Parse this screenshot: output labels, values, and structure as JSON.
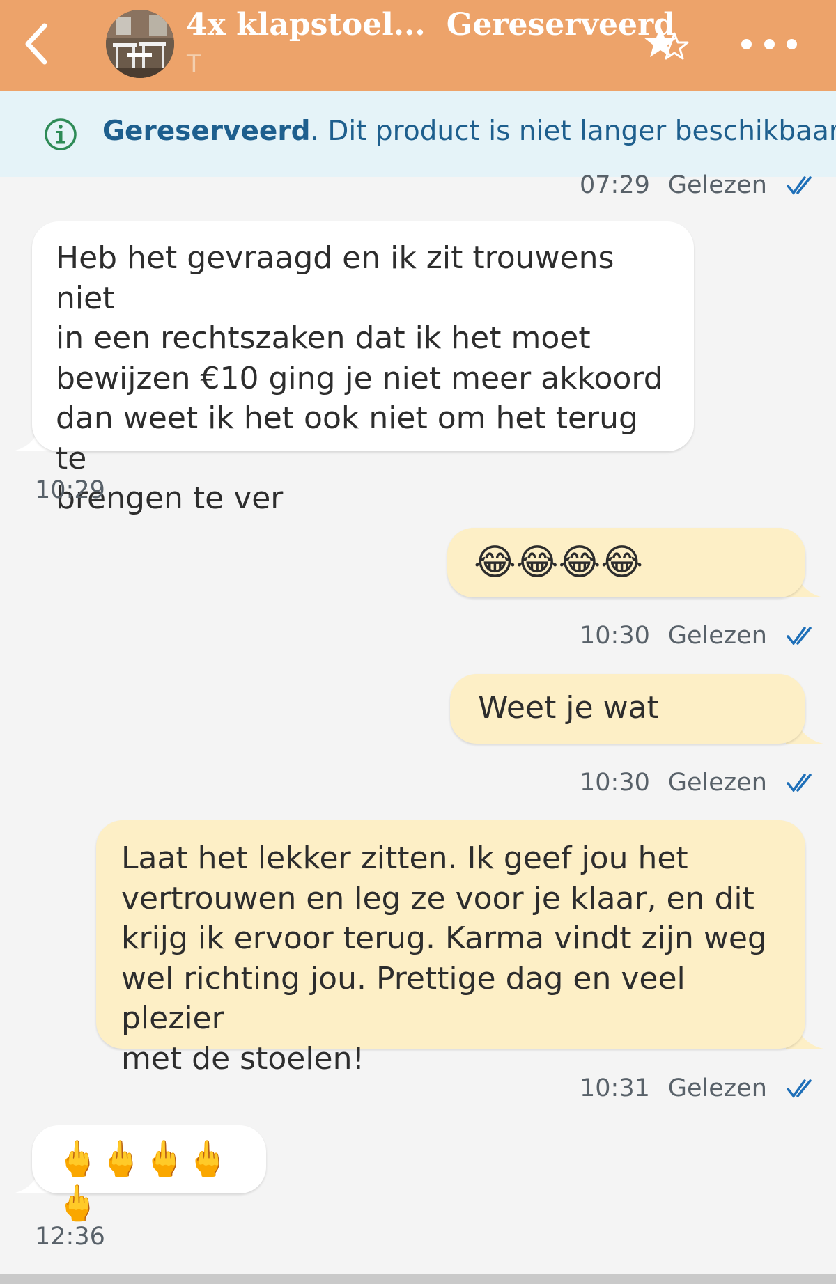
{
  "header": {
    "listing_title": "4x klapstoel...",
    "status": "Gereserveerd",
    "user_initial": "T",
    "colors": {
      "bar": "#eda36a",
      "text": "#ffffff"
    },
    "icons": {
      "back": "chevron-left-icon",
      "favorite": "star-icon",
      "more": "more-dots-icon"
    }
  },
  "banner": {
    "status_word": "Gereserveerd",
    "message": ". Dit product is niet langer beschikbaar.",
    "icon": "info-icon",
    "colors": {
      "background": "#e5f3f8",
      "text": "#1e5f8e",
      "icon": "#2e8b57"
    }
  },
  "read_label": "Gelezen",
  "messages": [
    {
      "id": "m0",
      "direction": "outgoing",
      "time": "07:29",
      "read": "Gelezen"
    },
    {
      "id": "m1",
      "direction": "incoming",
      "lines": [
        "Heb het gevraagd en ik zit trouwens niet",
        "in een rechtszaken dat ik het moet",
        "bewijzen €10 ging je niet meer akkoord",
        "dan weet ik het ook niet om het terug te",
        "brengen te ver"
      ],
      "time": "10:29"
    },
    {
      "id": "m2",
      "direction": "outgoing",
      "text": "😂😂😂😂",
      "time": "10:30",
      "read": "Gelezen"
    },
    {
      "id": "m3",
      "direction": "outgoing",
      "text": "Weet je wat",
      "time": "10:30",
      "read": "Gelezen"
    },
    {
      "id": "m4",
      "direction": "outgoing",
      "lines": [
        "Laat het lekker zitten. Ik geef jou het",
        "vertrouwen en leg ze voor je klaar, en dit",
        "krijg ik ervoor terug. Karma vindt zijn weg",
        "wel richting jou. Prettige dag en veel plezier",
        "met de stoelen!"
      ],
      "time": "10:31",
      "read": "Gelezen"
    },
    {
      "id": "m5",
      "direction": "incoming",
      "text": "🖕🖕🖕🖕🖕",
      "time": "12:36"
    }
  ],
  "colors": {
    "incoming_bubble": "#ffffff",
    "outgoing_bubble": "#fdefc6",
    "chat_background": "#f4f4f4",
    "read_check": "#1e6fb8"
  }
}
